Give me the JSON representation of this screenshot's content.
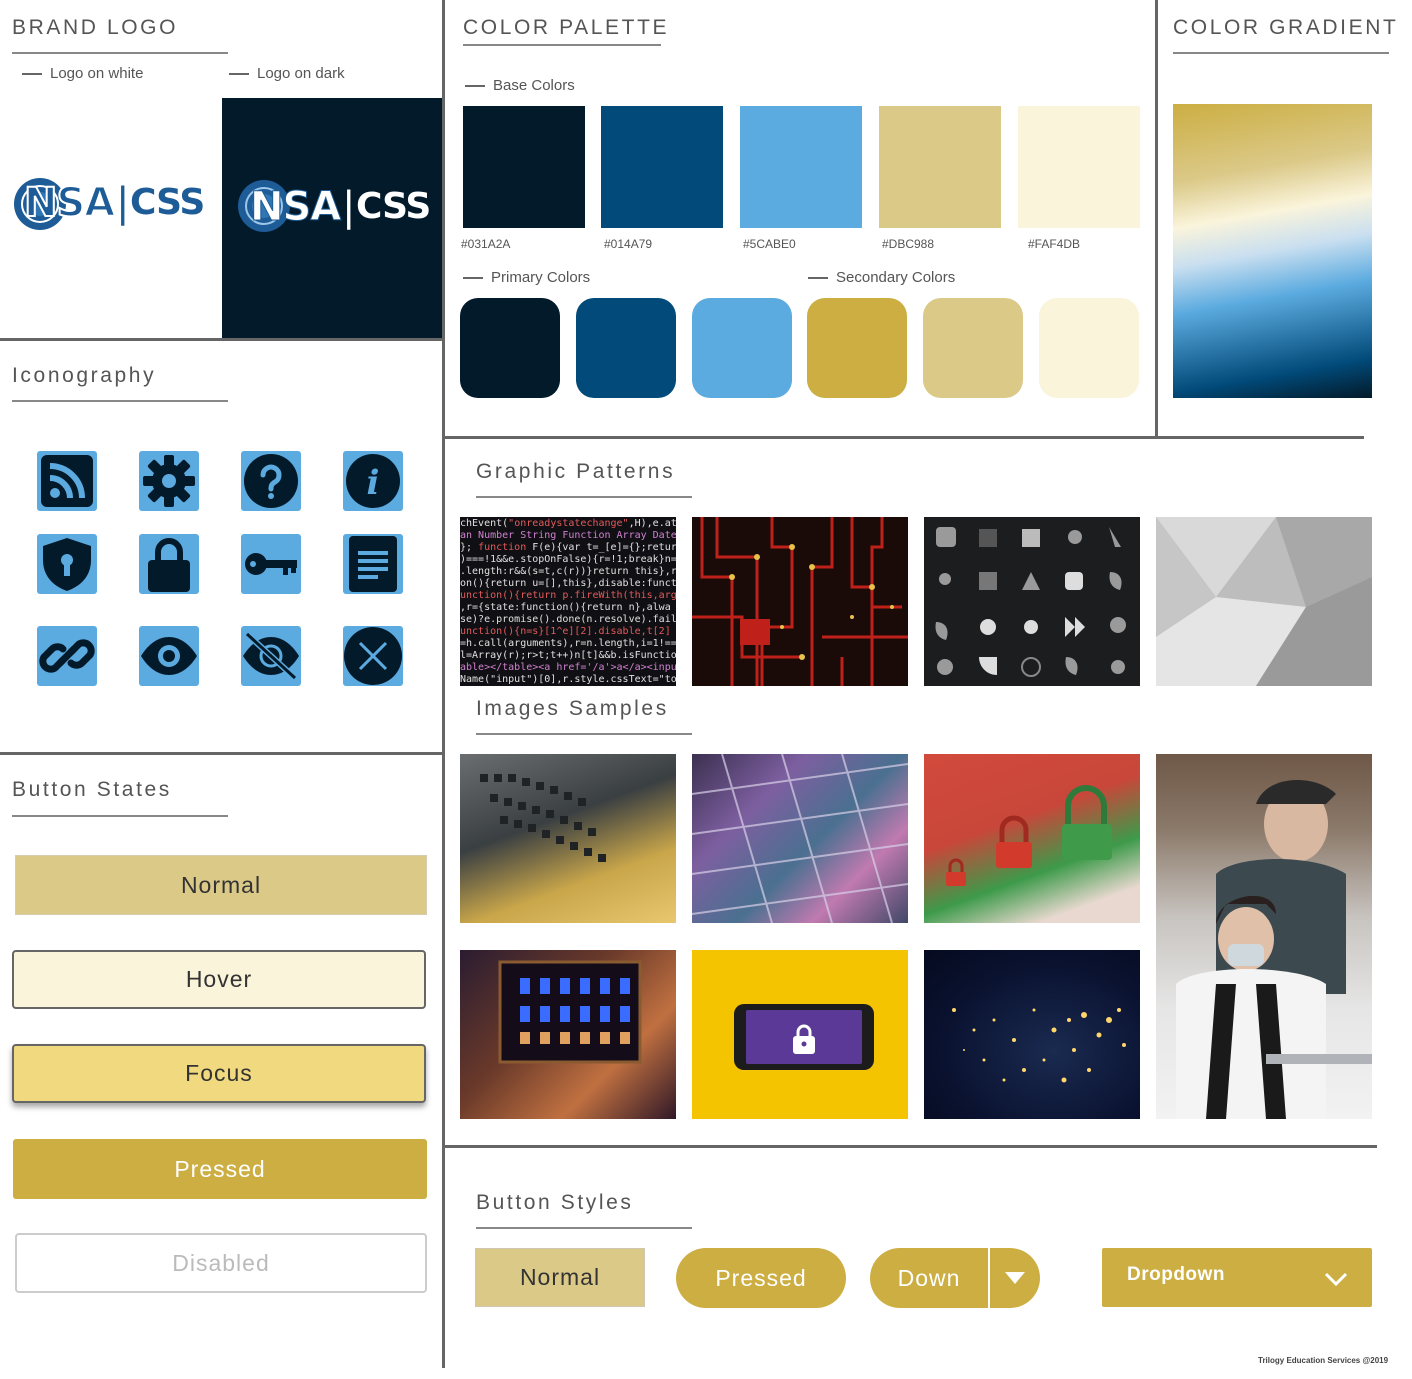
{
  "brand": {
    "title": "BRAND LOGO",
    "logo_white_label": "Logo on white",
    "logo_dark_label": "Logo on dark",
    "logo_nsa": "NSA",
    "logo_sep": "|",
    "logo_css": "CSS"
  },
  "palette": {
    "title": "COLOR PALETTE",
    "base_label": "Base Colors",
    "base": [
      {
        "code": "#031A2A",
        "color": "#031A2A"
      },
      {
        "code": "#014A79",
        "color": "#014A79"
      },
      {
        "code": "#5CABE0",
        "color": "#5CABE0"
      },
      {
        "code": "#DBC988",
        "color": "#DBC988"
      },
      {
        "code": "#FAF4DB",
        "color": "#FAF4DB"
      }
    ],
    "primary_label": "Primary Colors",
    "secondary_label": "Secondary Colors",
    "primary": [
      "#031A2A",
      "#014A79",
      "#5CABE0"
    ],
    "secondary": [
      "#CCAE42",
      "#DBC988",
      "#FAF4DB"
    ]
  },
  "gradient": {
    "title": "COLOR GRADIENT"
  },
  "iconography": {
    "title": "Iconography",
    "icons": [
      "rss-icon",
      "gear-icon",
      "question-icon",
      "info-icon",
      "shield-lock-icon",
      "padlock-icon",
      "key-icon",
      "document-icon",
      "link-icon",
      "eye-icon",
      "eye-slash-icon",
      "close-icon"
    ]
  },
  "button_states": {
    "title": "Button States",
    "normal": "Normal",
    "hover": "Hover",
    "focus": "Focus",
    "pressed": "Pressed",
    "disabled": "Disabled"
  },
  "patterns": {
    "title": "Graphic Patterns",
    "tiles": [
      "code-pattern",
      "circuit-pattern",
      "icon-grid-pattern",
      "geometric-pattern"
    ]
  },
  "images": {
    "title": "Images Samples",
    "tiles": [
      "cpu-pins",
      "silicon-wafer",
      "red-green-padlocks",
      "chip-closeup",
      "phone-lock",
      "earth-night-lights",
      "two-people-laptop"
    ]
  },
  "button_styles": {
    "title": "Button Styles",
    "normal": "Normal",
    "pressed": "Pressed",
    "down": "Down",
    "dropdown": "Dropdown"
  },
  "footer": {
    "credit": "Trilogy Education Services @2019"
  },
  "colors": {
    "navy": "#031A2A",
    "blue": "#014A79",
    "sky": "#5CABE0",
    "sand": "#DBC988",
    "cream": "#FAF4DB",
    "gold": "#CCAE42"
  }
}
